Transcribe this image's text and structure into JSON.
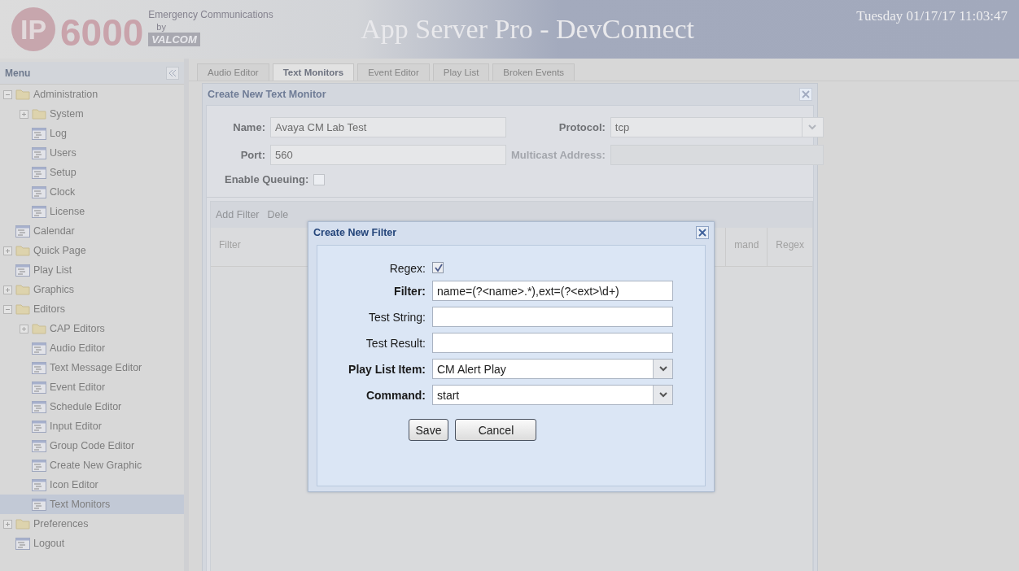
{
  "header": {
    "logo_mark": "IP",
    "logo_number": "6000",
    "tagline": "Emergency Communications",
    "by": "by",
    "brand": "VALCOM",
    "title": "App Server Pro - DevConnect",
    "datetime": "Tuesday 01/17/17 11:03:47"
  },
  "sidebar": {
    "title": "Menu",
    "items": [
      {
        "kind": "folder",
        "label": "Administration",
        "expanded": true,
        "selected": false,
        "children": [
          {
            "kind": "folder",
            "label": "System",
            "expanded": false,
            "selected": false
          },
          {
            "kind": "page",
            "label": "Log",
            "selected": false
          },
          {
            "kind": "page",
            "label": "Users",
            "selected": false
          },
          {
            "kind": "page",
            "label": "Setup",
            "selected": false
          },
          {
            "kind": "page",
            "label": "Clock",
            "selected": false
          },
          {
            "kind": "page",
            "label": "License",
            "selected": false
          }
        ]
      },
      {
        "kind": "page",
        "label": "Calendar",
        "selected": false
      },
      {
        "kind": "folder",
        "label": "Quick Page",
        "expanded": false,
        "selected": false
      },
      {
        "kind": "page",
        "label": "Play List",
        "selected": false
      },
      {
        "kind": "folder",
        "label": "Graphics",
        "expanded": false,
        "selected": false
      },
      {
        "kind": "folder",
        "label": "Editors",
        "expanded": true,
        "selected": false,
        "children": [
          {
            "kind": "folder",
            "label": "CAP Editors",
            "expanded": false,
            "selected": false
          },
          {
            "kind": "page",
            "label": "Audio Editor",
            "selected": false
          },
          {
            "kind": "page",
            "label": "Text Message Editor",
            "selected": false
          },
          {
            "kind": "page",
            "label": "Event Editor",
            "selected": false
          },
          {
            "kind": "page",
            "label": "Schedule Editor",
            "selected": false
          },
          {
            "kind": "page",
            "label": "Input Editor",
            "selected": false
          },
          {
            "kind": "page",
            "label": "Group Code Editor",
            "selected": false
          },
          {
            "kind": "page",
            "label": "Create New Graphic",
            "selected": false
          },
          {
            "kind": "page",
            "label": "Icon Editor",
            "selected": false
          },
          {
            "kind": "page",
            "label": "Text Monitors",
            "selected": true
          }
        ]
      },
      {
        "kind": "folder",
        "label": "Preferences",
        "expanded": false,
        "selected": false
      },
      {
        "kind": "page",
        "label": "Logout",
        "selected": false
      }
    ]
  },
  "tabs": [
    {
      "label": "Audio Editor",
      "selected": false
    },
    {
      "label": "Text Monitors",
      "selected": true
    },
    {
      "label": "Event Editor",
      "selected": false
    },
    {
      "label": "Play List",
      "selected": false
    },
    {
      "label": "Broken Events",
      "selected": false
    }
  ],
  "monitor_dialog": {
    "title": "Create New Text Monitor",
    "name": {
      "label": "Name:",
      "value": "Avaya CM Lab Test"
    },
    "protocol": {
      "label": "Protocol:",
      "value": "tcp"
    },
    "port": {
      "label": "Port:",
      "value": "560"
    },
    "multicast": {
      "label": "Multicast Address:",
      "disabled": true
    },
    "queuing": {
      "label": "Enable Queuing:",
      "checked": false
    },
    "toolbar": [
      "Add Filter",
      "Dele"
    ],
    "columns": [
      "Filter",
      "mand",
      "Regex"
    ]
  },
  "filter_dialog": {
    "title": "Create New Filter",
    "fields": [
      {
        "kind": "checkbox",
        "label": "Regex:",
        "required": false,
        "checked": true
      },
      {
        "kind": "text",
        "label": "Filter:",
        "required": true,
        "value": "name=(?<name>.*),ext=(?<ext>\\d+)"
      },
      {
        "kind": "text",
        "label": "Test String:",
        "required": false
      },
      {
        "kind": "text",
        "label": "Test Result:",
        "required": false
      },
      {
        "kind": "select",
        "label": "Play List Item:",
        "required": true,
        "value": "CM Alert Play"
      },
      {
        "kind": "select",
        "label": "Command:",
        "required": true,
        "value": "start"
      }
    ],
    "buttons": [
      "Save",
      "Cancel"
    ]
  }
}
